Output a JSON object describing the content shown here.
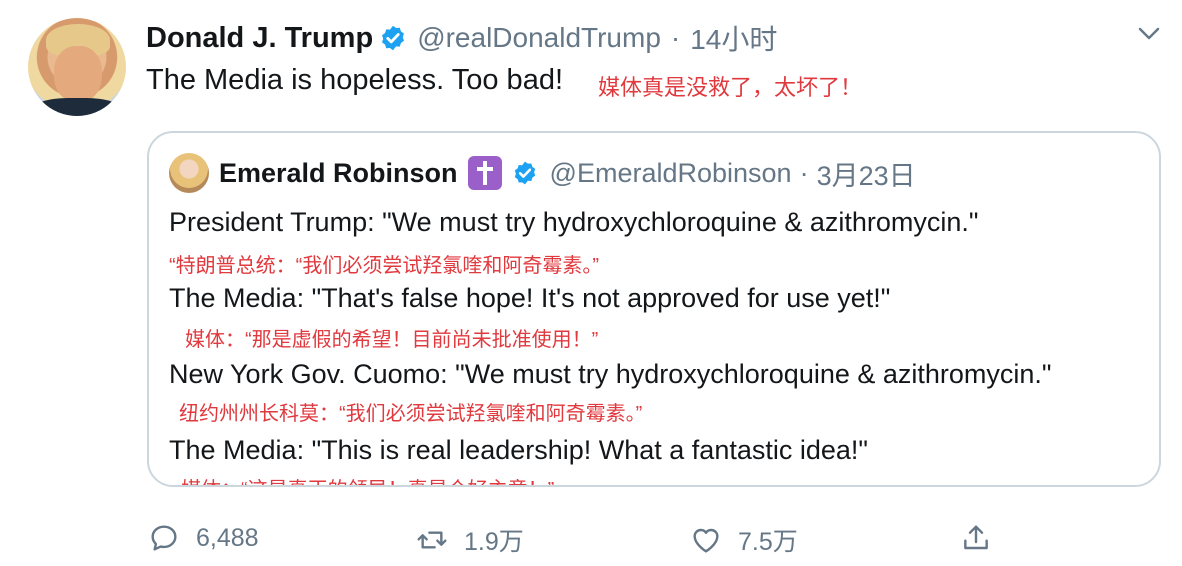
{
  "tweet": {
    "author_name": "Donald J. Trump",
    "handle": "@realDonaldTrump",
    "separator": "·",
    "time": "14小时",
    "text": "The Media is hopeless. Too bad!",
    "translation": "媒体真是没救了，太坏了！"
  },
  "quote": {
    "author_name": "Emerald Robinson",
    "handle": "@EmeraldRobinson",
    "separator": "·",
    "date": "3月23日",
    "lines": [
      {
        "text": "President Trump: \"We must try hydroxychloroquine & azithromycin.\"",
        "translation": "“特朗普总统：“我们必须尝试羟氯喹和阿奇霉素。”"
      },
      {
        "text": "The Media: \"That's false hope! It's not approved for use yet!\"",
        "translation": "媒体：“那是虚假的希望！目前尚未批准使用！”"
      },
      {
        "text": "New York Gov. Cuomo: \"We must try hydroxychloroquine & azithromycin.\"",
        "translation": "纽约州州长科莫：“我们必须尝试羟氯喹和阿奇霉素。”"
      },
      {
        "text": "The Media: \"This is real leadership! What a fantastic idea!\"",
        "translation": "媒体：“这是真正的领导！真是个好主意！”"
      }
    ]
  },
  "actions": {
    "reply_count": "6,488",
    "retweet_count": "1.9万",
    "like_count": "7.5万"
  },
  "icons": {
    "verified": "verified-badge-icon",
    "cross": "cross-emoji-icon",
    "chevron": "chevron-down-icon",
    "reply": "reply-icon",
    "retweet": "retweet-icon",
    "like": "heart-icon",
    "share": "share-icon"
  },
  "colors": {
    "verified_blue": "#1da1f2",
    "secondary_text": "#657786",
    "translation_red": "#e0393e",
    "border": "#ccd6dd"
  }
}
